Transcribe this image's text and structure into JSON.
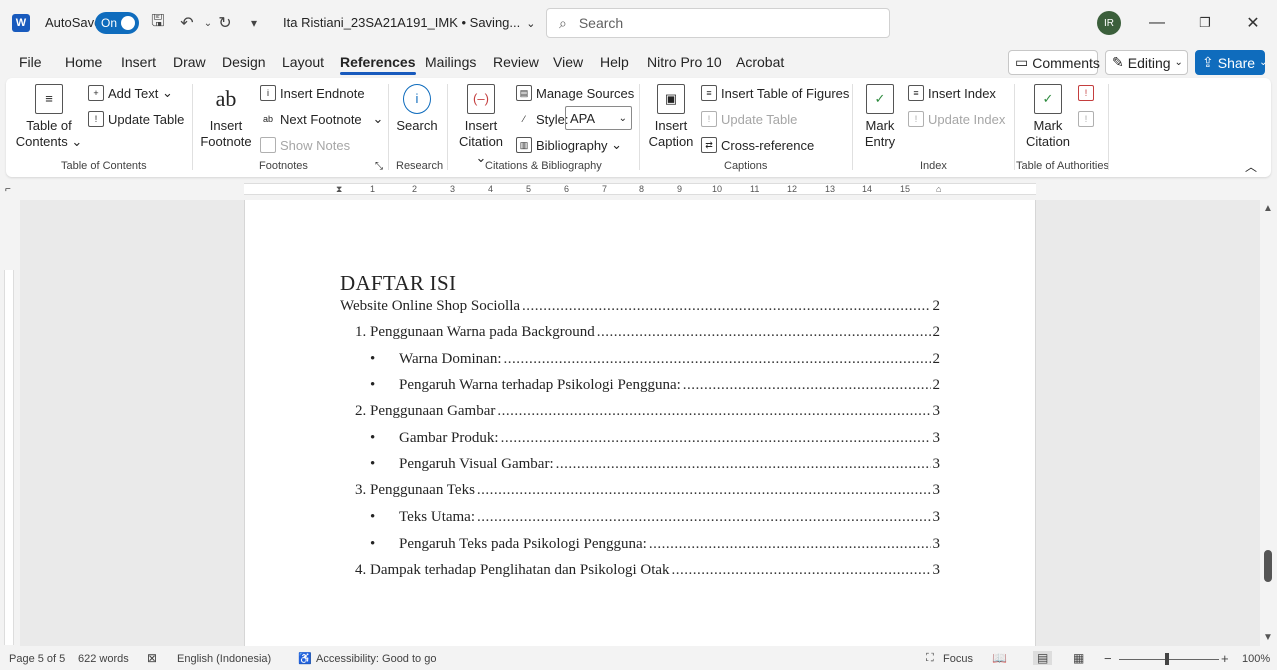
{
  "titlebar": {
    "autosave_label": "AutoSave",
    "autosave_state": "On",
    "doc_title": "Ita Ristiani_23SA21A191_IMK • Saving...",
    "search_placeholder": "Search",
    "avatar_initials": "IR"
  },
  "tabs": [
    "File",
    "Home",
    "Insert",
    "Draw",
    "Design",
    "Layout",
    "References",
    "Mailings",
    "Review",
    "View",
    "Help",
    "Nitro Pro 10",
    "Acrobat"
  ],
  "active_tab": "References",
  "top_right": {
    "comments": "Comments",
    "editing": "Editing",
    "share": "Share"
  },
  "ribbon": {
    "toc": {
      "table_of_contents": "Table of Contents",
      "add_text": "Add Text",
      "update_table": "Update Table",
      "group": "Table of Contents"
    },
    "footnotes": {
      "insert_footnote": "Insert Footnote",
      "insert_endnote": "Insert Endnote",
      "next_footnote": "Next Footnote",
      "show_notes": "Show Notes",
      "group": "Footnotes"
    },
    "research": {
      "search": "Search",
      "group": "Research"
    },
    "citations": {
      "insert_citation": "Insert Citation",
      "manage_sources": "Manage Sources",
      "style_label": "Style:",
      "style_value": "APA",
      "bibliography": "Bibliography",
      "group": "Citations & Bibliography"
    },
    "captions": {
      "insert_caption": "Insert Caption",
      "insert_table_of_figures": "Insert Table of Figures",
      "update_table": "Update Table",
      "cross_reference": "Cross-reference",
      "group": "Captions"
    },
    "index": {
      "mark_entry": "Mark Entry",
      "insert_index": "Insert Index",
      "update_index": "Update Index",
      "group": "Index"
    },
    "authorities": {
      "mark_citation": "Mark Citation",
      "group": "Table of Authorities"
    }
  },
  "ruler_numbers": [
    "1",
    "1",
    "2",
    "3",
    "4",
    "5",
    "6",
    "7",
    "8",
    "9",
    "10",
    "11",
    "12",
    "13",
    "14",
    "15"
  ],
  "document": {
    "toc_title": "DAFTAR ISI",
    "entries": [
      {
        "text": "Website Online Shop Sociolla",
        "page": "2"
      },
      {
        "text": "1. Penggunaan Warna pada Background",
        "page": "2"
      },
      {
        "text": "Warna Dominan:",
        "page": "2"
      },
      {
        "text": "Pengaruh Warna terhadap Psikologi Pengguna:",
        "page": "2"
      },
      {
        "text": "2. Penggunaan Gambar",
        "page": "3"
      },
      {
        "text": "Gambar Produk:",
        "page": "3"
      },
      {
        "text": "Pengaruh Visual Gambar:",
        "page": "3"
      },
      {
        "text": "3. Penggunaan Teks",
        "page": "3"
      },
      {
        "text": "Teks Utama:",
        "page": "3"
      },
      {
        "text": "Pengaruh Teks pada Psikologi Pengguna:",
        "page": "3"
      },
      {
        "text": "4. Dampak terhadap Penglihatan dan Psikologi Otak",
        "page": "3"
      }
    ]
  },
  "status": {
    "page": "Page 5 of 5",
    "words": "622 words",
    "language": "English (Indonesia)",
    "accessibility": "Accessibility: Good to go",
    "focus": "Focus",
    "zoom": "100%"
  }
}
